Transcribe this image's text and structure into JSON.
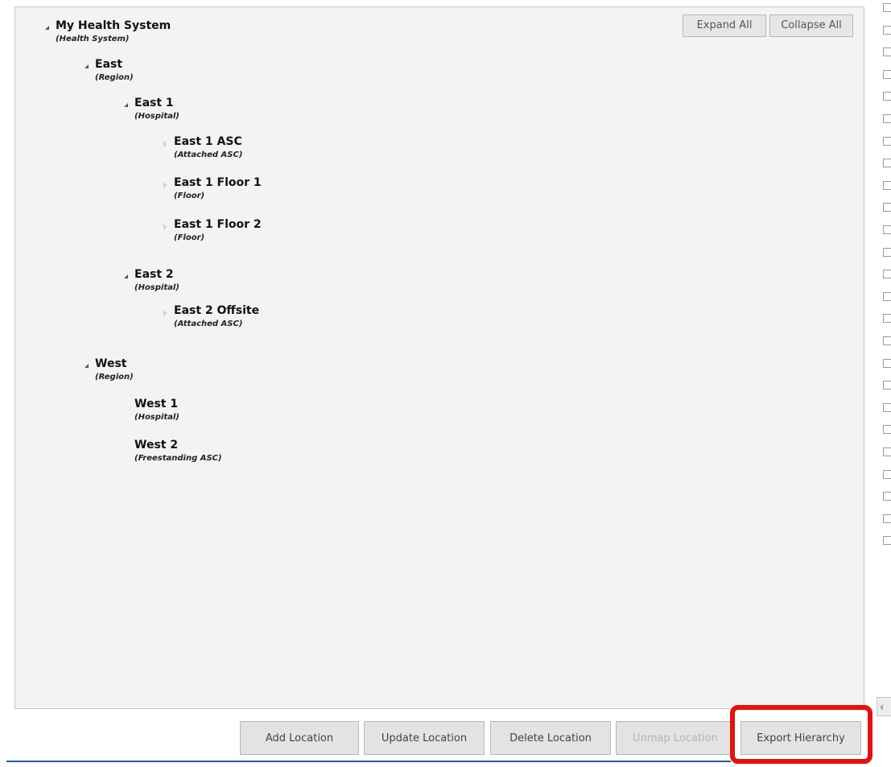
{
  "toolbar": {
    "expand_all": "Expand All",
    "collapse_all": "Collapse All"
  },
  "tree": {
    "root": {
      "name": "My Health System",
      "type": "(Health System)",
      "state": "expanded"
    },
    "east": {
      "name": "East",
      "type": "(Region)",
      "state": "expanded"
    },
    "east1": {
      "name": "East 1",
      "type": "(Hospital)",
      "state": "expanded"
    },
    "east1_asc": {
      "name": "East 1 ASC",
      "type": "(Attached ASC)",
      "state": "collapsed"
    },
    "east1_floor1": {
      "name": "East 1 Floor 1",
      "type": "(Floor)",
      "state": "collapsed"
    },
    "east1_floor2": {
      "name": "East 1 Floor 2",
      "type": "(Floor)",
      "state": "collapsed"
    },
    "east2": {
      "name": "East 2",
      "type": "(Hospital)",
      "state": "expanded"
    },
    "east2_offsite": {
      "name": "East 2 Offsite",
      "type": "(Attached ASC)",
      "state": "collapsed"
    },
    "west": {
      "name": "West",
      "type": "(Region)",
      "state": "expanded"
    },
    "west1": {
      "name": "West 1",
      "type": "(Hospital)",
      "state": "leaf"
    },
    "west2": {
      "name": "West 2",
      "type": "(Freestanding ASC)",
      "state": "leaf"
    }
  },
  "actions": {
    "add": "Add Location",
    "update": "Update Location",
    "delete": "Delete Location",
    "unmap": "Unmap Location",
    "export": "Export Hierarchy"
  },
  "colors": {
    "highlight": "#e3120b",
    "panel_bg": "#f3f3f3",
    "accent_line": "#1f5fa8"
  }
}
